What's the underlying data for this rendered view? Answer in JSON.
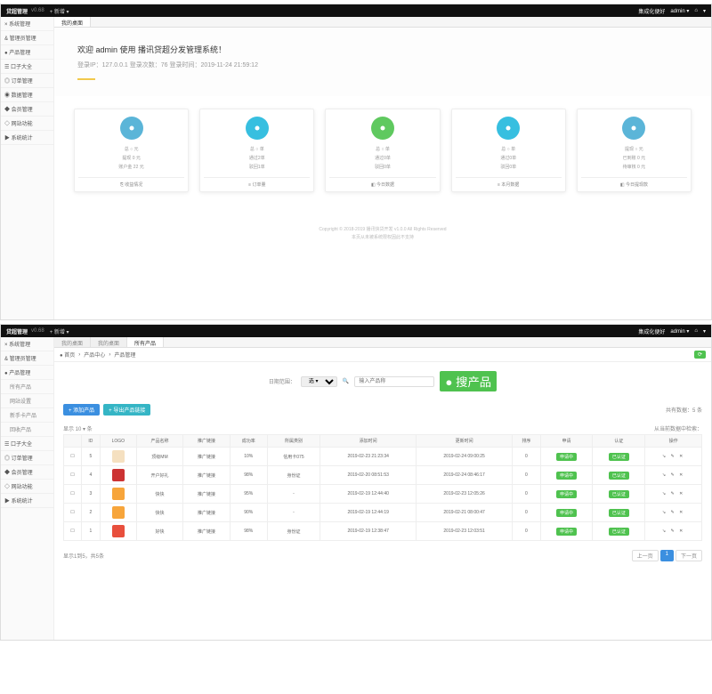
{
  "topbar": {
    "brand": "贷超管理",
    "ver": "v0.68",
    "add": "+ 新增 ▾",
    "welcome": "集成化便好",
    "user": "admin ▾"
  },
  "sidebar": {
    "items": [
      {
        "label": "× 系统管理"
      },
      {
        "label": "& 管理员管理"
      },
      {
        "label": "● 产品管理"
      },
      {
        "label": "☰ 口子大全"
      },
      {
        "label": "◎ 订单管理"
      },
      {
        "label": "◉ 数据管理"
      },
      {
        "label": "◆ 会员管理"
      },
      {
        "label": "◇ 网站功能"
      },
      {
        "label": "▶ 系统统计"
      }
    ]
  },
  "tabs1": [
    {
      "label": "我的桌面"
    }
  ],
  "welcome": {
    "h1": "欢迎 admin 使用 播讯贷超分发管理系统！",
    "sub": "登录IP：127.0.0.1 登录次数：76 登录时间：2019-11-24 21:59:12"
  },
  "cards": [
    {
      "c": "c1",
      "ln1": "总 ○ 元",
      "ln2": "提现 0 元",
      "ln3": "账户金 22 元",
      "ft": "⎘ 收益情况"
    },
    {
      "c": "c2",
      "ln1": "总 ○ 单",
      "ln2": "通过2单",
      "ln3": "驳回1单",
      "ft": "≡ 订单量"
    },
    {
      "c": "c3",
      "ln1": "总 ○ 单",
      "ln2": "通过0单",
      "ln3": "驳回0单",
      "ft": "◧ 今日数据"
    },
    {
      "c": "c4",
      "ln1": "总 ○ 单",
      "ln2": "通过0单",
      "ln3": "驳回0单",
      "ft": "≡ 本月数据"
    },
    {
      "c": "c5",
      "ln1": "提现 ○ 元",
      "ln2": "已到账 0 元",
      "ln3": "待审核 0 元",
      "ft": "◧ 今日提现款"
    }
  ],
  "footer": {
    "l1": "Copyright © 2018-2019 播讯快贷开发 v1.0.0 All Rights Reserved",
    "l2": "本页从未被系统限权因此不支持"
  },
  "tabs2": [
    {
      "label": "我的桌面",
      "cls": "inactive"
    },
    {
      "label": "我的桌面",
      "cls": "inactive"
    },
    {
      "label": "所有产品"
    }
  ],
  "crumb": {
    "home": "● 首页",
    "a": "产品中心",
    "b": "产品管理"
  },
  "sidebar2": {
    "items": [
      {
        "label": "× 系统管理"
      },
      {
        "label": "& 管理员管理"
      },
      {
        "label": "● 产品管理",
        "open": true
      },
      {
        "label": "所有产品",
        "sub": true
      },
      {
        "label": "网站设置",
        "sub": true
      },
      {
        "label": "新手卡产品",
        "sub": true
      },
      {
        "label": "回收产品",
        "sub": true
      },
      {
        "label": "☰ 口子大全"
      },
      {
        "label": "◎ 订单管理"
      },
      {
        "label": "◆ 会员管理"
      },
      {
        "label": "◇ 网站功能"
      },
      {
        "label": "▶ 系统统计"
      }
    ]
  },
  "filters": {
    "l1": "日期范围：",
    "sel": "选 ▾",
    "ph": "输入产品称",
    "btn": "● 搜产品"
  },
  "toolbar": {
    "b1": "+ 添加产品",
    "b2": "+ 导出产品链接",
    "right": "共有数据：5 条"
  },
  "tblhead": {
    "l": "显示 10 ▾ 条",
    "r": "从当前数据中检索："
  },
  "cols": [
    "",
    "ID",
    "LOGO",
    "产品名称",
    "推广链接",
    "成功率",
    "所属类别",
    "添加时间",
    "更新时间",
    "排序",
    "申请",
    "认证",
    "操作"
  ],
  "rows": [
    {
      "id": "5",
      "logo": "l1",
      "name": "顶级MM",
      "link": "推广链接",
      "rate": "10%",
      "cat": "信用卡075",
      "add": "2019-02-23 21:23:34",
      "upd": "2019-02-24 09:00:25",
      "sort": "0",
      "a": "申请中",
      "b": "已认证"
    },
    {
      "id": "4",
      "logo": "l2",
      "name": "开户好礼",
      "link": "推广链接",
      "rate": "98%",
      "cat": "身份证",
      "add": "2019-02-20 08:51:53",
      "upd": "2019-02-24 08:46:17",
      "sort": "0",
      "a": "申请中",
      "b": "已认证"
    },
    {
      "id": "3",
      "logo": "l3",
      "name": "快快",
      "link": "推广链接",
      "rate": "95%",
      "cat": "-",
      "add": "2019-02-19 12:44:40",
      "upd": "2019-02-23 12:05:26",
      "sort": "0",
      "a": "申请中",
      "b": "已认证"
    },
    {
      "id": "2",
      "logo": "l4",
      "name": "快快",
      "link": "推广链接",
      "rate": "90%",
      "cat": "-",
      "add": "2019-02-19 12:44:19",
      "upd": "2019-02-21 08:00:47",
      "sort": "0",
      "a": "申请中",
      "b": "已认证"
    },
    {
      "id": "1",
      "logo": "l5",
      "name": "好快",
      "link": "推广链接",
      "rate": "98%",
      "cat": "身份证",
      "add": "2019-02-19 12:38:47",
      "upd": "2019-02-23 12:03:51",
      "sort": "0",
      "a": "申请中",
      "b": "已认证"
    }
  ],
  "pager": {
    "info": "显示1到5，共5条",
    "prev": "上一页",
    "cur": "1",
    "next": "下一页"
  }
}
